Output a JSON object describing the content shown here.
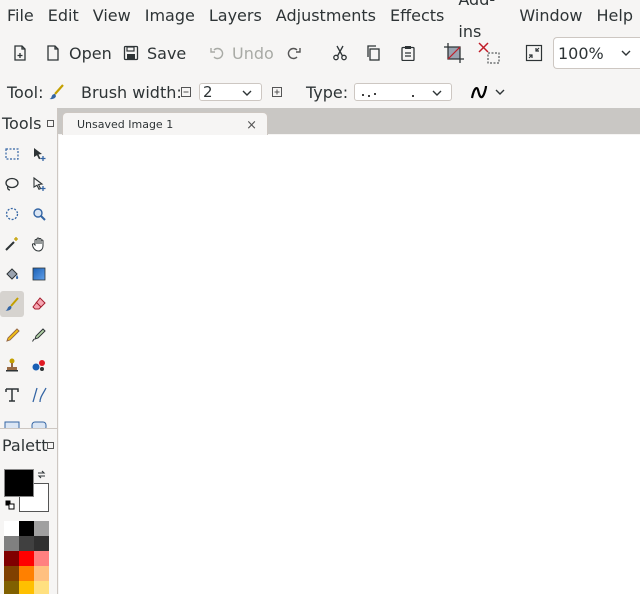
{
  "menu": [
    "File",
    "Edit",
    "View",
    "Image",
    "Layers",
    "Adjustments",
    "Effects",
    "Add-ins",
    "Window",
    "Help"
  ],
  "toolbar": {
    "open_label": "Open",
    "save_label": "Save",
    "undo_label": "Undo",
    "zoom_value": "100%"
  },
  "tool_options": {
    "tool_label": "Tool:",
    "brush_width_label": "Brush width:",
    "brush_width_value": "2",
    "type_label": "Type:"
  },
  "tools_panel": {
    "title": "Tools",
    "active_tool": "paintbrush"
  },
  "palette_panel": {
    "title": "Palett",
    "primary_color": "#000000",
    "secondary_color": "#ffffff",
    "swatches": [
      [
        "#ffffff",
        "#000000",
        "#a0a0a0"
      ],
      [
        "#808080",
        "#404040",
        "#303030"
      ],
      [
        "#800000",
        "#ff0000",
        "#ff8080"
      ],
      [
        "#804000",
        "#ff8000",
        "#ffc080"
      ],
      [
        "#806000",
        "#ffc000",
        "#ffe080"
      ]
    ]
  },
  "document": {
    "tab_title": "Unsaved Image 1",
    "close_glyph": "×"
  }
}
